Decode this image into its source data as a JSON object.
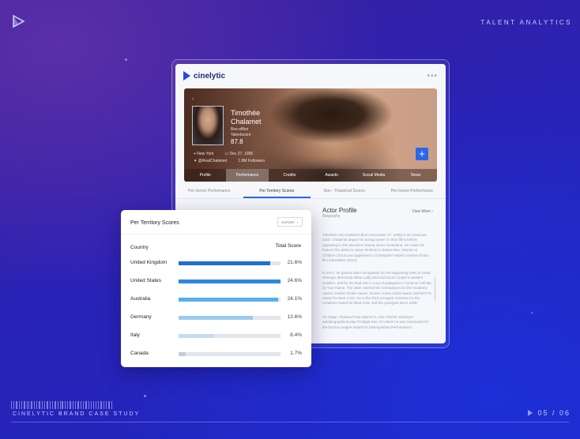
{
  "top_title": "TALENT ANALYTICS",
  "footer": {
    "title": "CINELYTIC BRAND CASE STUDY",
    "page": "05 / 06"
  },
  "app": {
    "logo_text": "cinelytic",
    "hero": {
      "name_line1": "Timothée",
      "name_line2": "Chalamet",
      "sub_line1": "Box-office",
      "sub_line2": "Talentscore",
      "score": "87.8",
      "location": "New York",
      "birthdate": "Dec 27, 1995",
      "handle": "@RealChalamet",
      "followers": "1.9M Followers",
      "tabs": [
        "Profile",
        "Performance",
        "Credits",
        "Awards",
        "Social Media",
        "News"
      ],
      "active_tab": "Performance"
    },
    "sub_tabs": [
      "Per-Genre Performance",
      "Per Territory Scores",
      "Non - Theatrical Scores",
      "Per-Genre Performance"
    ],
    "active_sub_tab": "Per Territory Scores",
    "profile": {
      "title": "Actor Profile",
      "subtitle": "Biography",
      "view_more": "View More",
      "paragraphs": [
        "Timothée Hal Chalamet (born December 27, 1995) is an American actor. Chalamet began his acting career in short films before appearing in the television drama series Homeland. He made his feature film debut in Jason Reitman's drama Men, Women & Children (2014) and appeared in Christopher Nolan's science fiction film Interstellar (2014).",
        "In 2017, he gained wider recognition for his supporting roles in Greta Gerwig's directorial debut Lady Bird and Scott Cooper's western Hostiles, and for his lead role in Luca Guadagnino's romance Call Me by Your Name. The latter earned him nominations for the Academy Award, Golden Globe Award, Screen Actors Guild Award, and BAFTA Award for Best Actor. He is the third youngest nominee for the Academy Award for Best Actor and the youngest since 1939.",
        "On stage, Chalamet has starred in John Patrick Shanley's autobiographical play Prodigal Son, for which he was nominated for the Drama League Award for Distinguished Performance..."
      ]
    }
  },
  "territory_card": {
    "title": "Per Territory Scores",
    "export_label": "EXPORT",
    "col_country": "Country",
    "col_score": "Total Score",
    "rows": [
      {
        "country": "United Kingdom",
        "label": "21.6%",
        "fill": 0.9,
        "color": "#1f6fd1"
      },
      {
        "country": "United States",
        "label": "24.6%",
        "fill": 1.0,
        "color": "#2e86de"
      },
      {
        "country": "Australia",
        "label": "24.1%",
        "fill": 0.98,
        "color": "#5aaee8"
      },
      {
        "country": "Germany",
        "label": "13.6%",
        "fill": 0.73,
        "color": "#9ccbee"
      },
      {
        "country": "Italy",
        "label": "8.4%",
        "fill": 0.34,
        "color": "#c2dcf2"
      },
      {
        "country": "Canada",
        "label": "1.7%",
        "fill": 0.07,
        "color": "#c9ccd6"
      }
    ]
  }
}
